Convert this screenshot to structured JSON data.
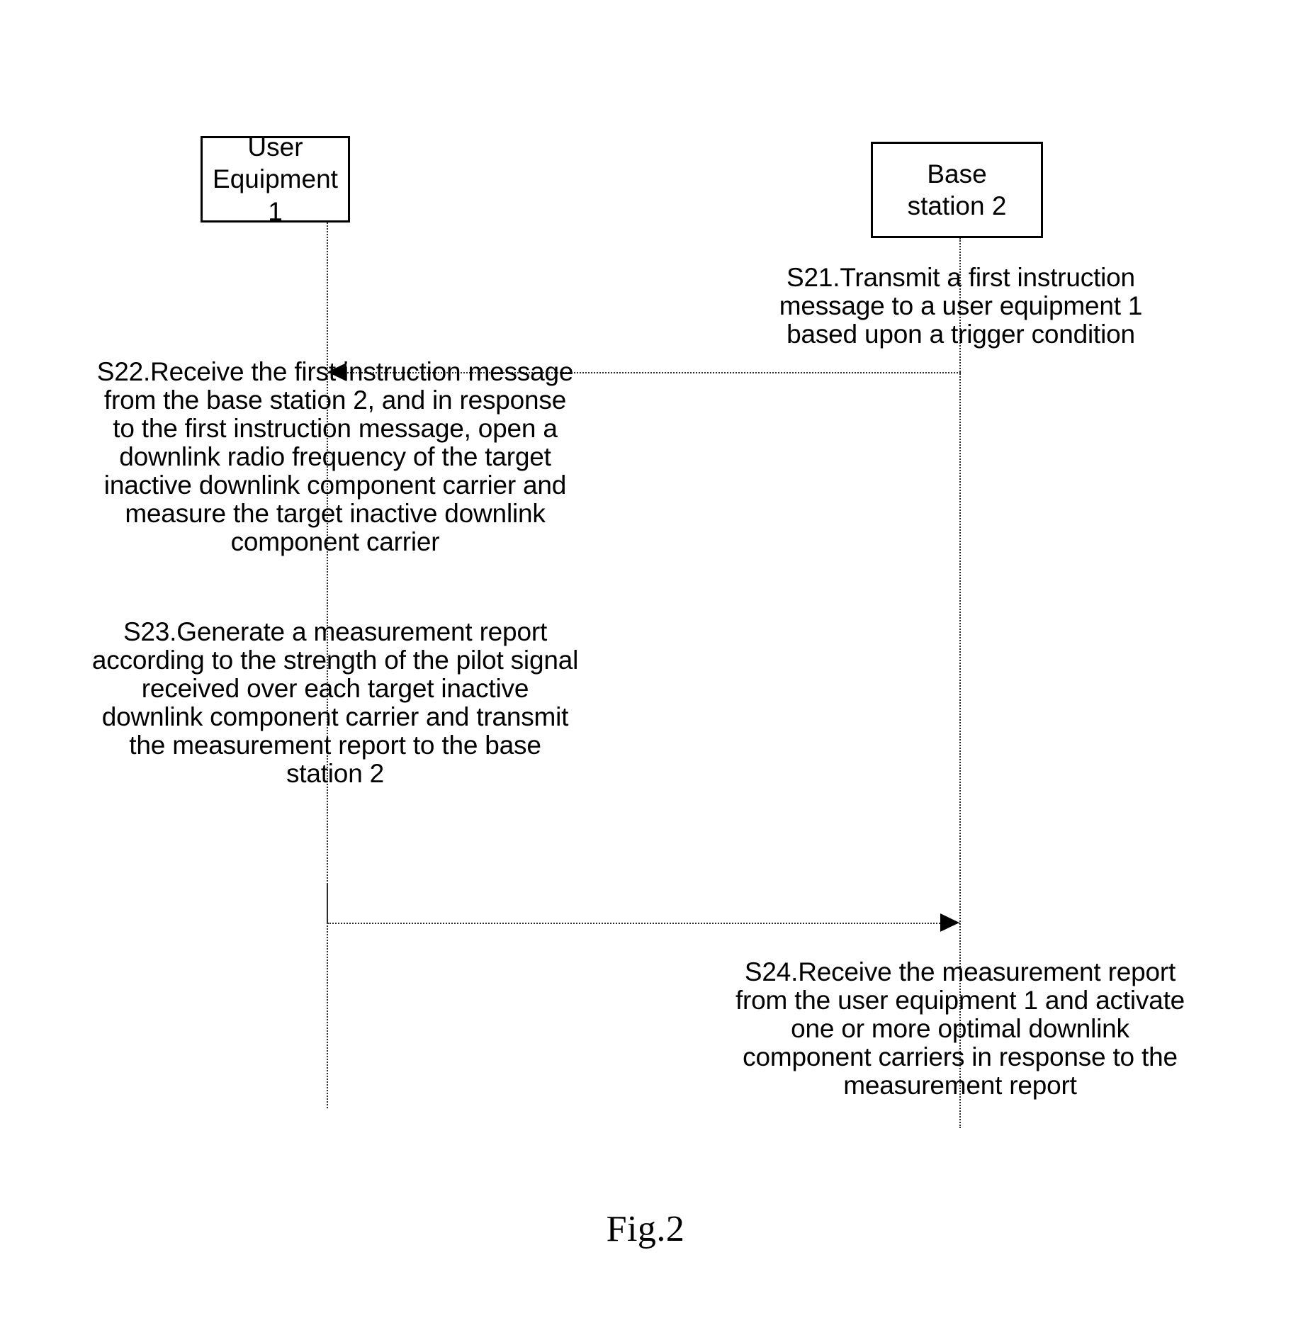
{
  "figure": {
    "caption": "Fig.2"
  },
  "actors": [
    {
      "id": "user-equipment-1",
      "label": "User\nEquipment\n1"
    },
    {
      "id": "base-station-2",
      "label": "Base\nstation 2"
    }
  ],
  "steps": [
    {
      "id": "S21",
      "owner": "base-station-2",
      "text": "S21.Transmit a first instruction message to a user equipment 1 based upon a trigger condition"
    },
    {
      "id": "S22",
      "owner": "user-equipment-1",
      "text": "S22.Receive the first instruction message from the base station 2, and in response to the first instruction message, open a downlink radio frequency of the target inactive downlink component carrier and measure the target inactive downlink component carrier"
    },
    {
      "id": "S23",
      "owner": "user-equipment-1",
      "text": "S23.Generate a measurement report according to the strength of the pilot signal received over each target inactive downlink component carrier and transmit the measurement report to the base station 2"
    },
    {
      "id": "S24",
      "owner": "base-station-2",
      "text": "S24.Receive the measurement report from the user equipment 1 and activate one or more optimal downlink component carriers in response to the measurement report"
    }
  ],
  "messages": [
    {
      "id": "msg-s21",
      "from": "base-station-2",
      "to": "user-equipment-1",
      "direction": "left"
    },
    {
      "id": "msg-s24",
      "from": "user-equipment-1",
      "to": "base-station-2",
      "direction": "right"
    }
  ],
  "colors": {
    "ink": "#000000",
    "line": "#2b2b2b",
    "background": "#ffffff"
  }
}
